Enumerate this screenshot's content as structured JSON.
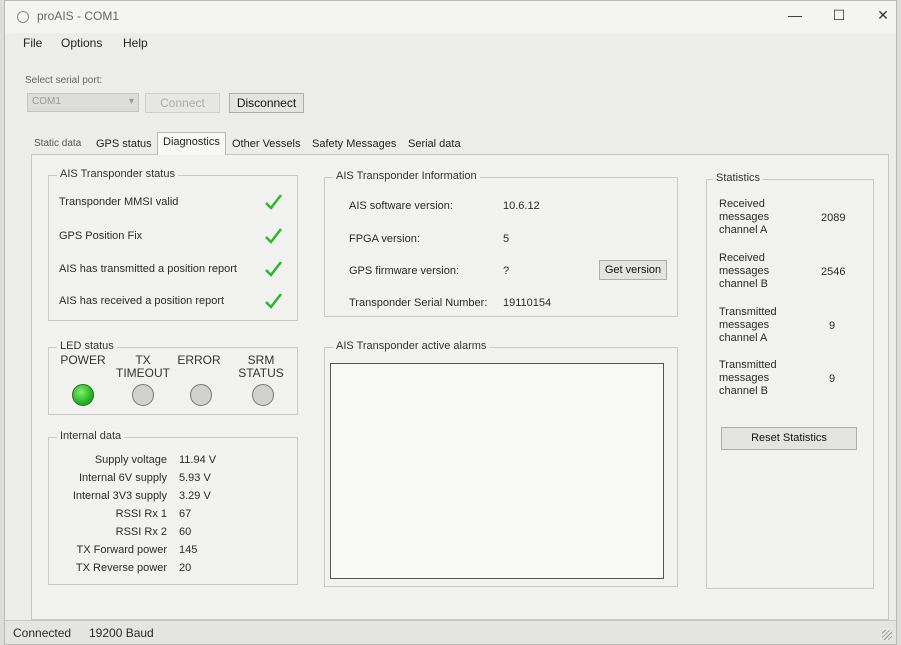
{
  "window": {
    "title": "proAIS - COM1",
    "controls": {
      "minimize": "—",
      "maximize": "☐",
      "close": "✕"
    }
  },
  "menu": {
    "file": "File",
    "options": "Options",
    "help": "Help"
  },
  "serial": {
    "label": "Select serial port:",
    "port_value": "COM1",
    "connect_label": "Connect",
    "disconnect_label": "Disconnect"
  },
  "tabs": [
    {
      "label": "Static data"
    },
    {
      "label": "GPS status"
    },
    {
      "label": "Diagnostics"
    },
    {
      "label": "Other Vessels"
    },
    {
      "label": "Safety Messages"
    },
    {
      "label": "Serial data"
    }
  ],
  "transponder_status": {
    "title": "AIS Transponder status",
    "items": [
      {
        "label": "Transponder MMSI valid",
        "ok": true
      },
      {
        "label": "GPS Position Fix",
        "ok": true
      },
      {
        "label": "AIS has transmitted a position report",
        "ok": true
      },
      {
        "label": "AIS has received a position report",
        "ok": true
      }
    ]
  },
  "led_status": {
    "title": "LED status",
    "leds": [
      {
        "label_line1": "",
        "label_line2": "POWER",
        "on": true
      },
      {
        "label_line1": "TX",
        "label_line2": "TIMEOUT",
        "on": false
      },
      {
        "label_line1": "",
        "label_line2": "ERROR",
        "on": false
      },
      {
        "label_line1": "SRM",
        "label_line2": "STATUS",
        "on": false
      }
    ]
  },
  "internal_data": {
    "title": "Internal data",
    "rows": [
      {
        "label": "Supply voltage",
        "value": "11.94 V"
      },
      {
        "label": "Internal 6V supply",
        "value": "5.93 V"
      },
      {
        "label": "Internal 3V3 supply",
        "value": "3.29 V"
      },
      {
        "label": "RSSI Rx 1",
        "value": "67"
      },
      {
        "label": "RSSI Rx 2",
        "value": "60"
      },
      {
        "label": "TX Forward power",
        "value": "145"
      },
      {
        "label": "TX Reverse power",
        "value": "20"
      }
    ]
  },
  "transponder_info": {
    "title": "AIS Transponder Information",
    "rows": [
      {
        "label": "AIS software version:",
        "value": "10.6.12"
      },
      {
        "label": "FPGA version:",
        "value": "5"
      },
      {
        "label": "GPS firmware version:",
        "value": "?"
      },
      {
        "label": "Transponder Serial Number:",
        "value": "19110154"
      }
    ],
    "get_version_label": "Get version"
  },
  "alarms": {
    "title": "AIS Transponder active alarms"
  },
  "statistics": {
    "title": "Statistics",
    "rows": [
      {
        "label_1": "Received",
        "label_2": "messages",
        "label_3": "channel A",
        "value": "2089"
      },
      {
        "label_1": "Received",
        "label_2": "messages",
        "label_3": "channel B",
        "value": "2546"
      },
      {
        "label_1": "Transmitted",
        "label_2": "messages",
        "label_3": "channel A",
        "value": "9"
      },
      {
        "label_1": "Transmitted",
        "label_2": "messages",
        "label_3": "channel B",
        "value": "9"
      }
    ],
    "reset_label": "Reset Statistics"
  },
  "status_bar": {
    "connection": "Connected",
    "baud": "19200 Baud"
  },
  "colors": {
    "check_green": "#2db82d",
    "led_on": "#27b427"
  }
}
